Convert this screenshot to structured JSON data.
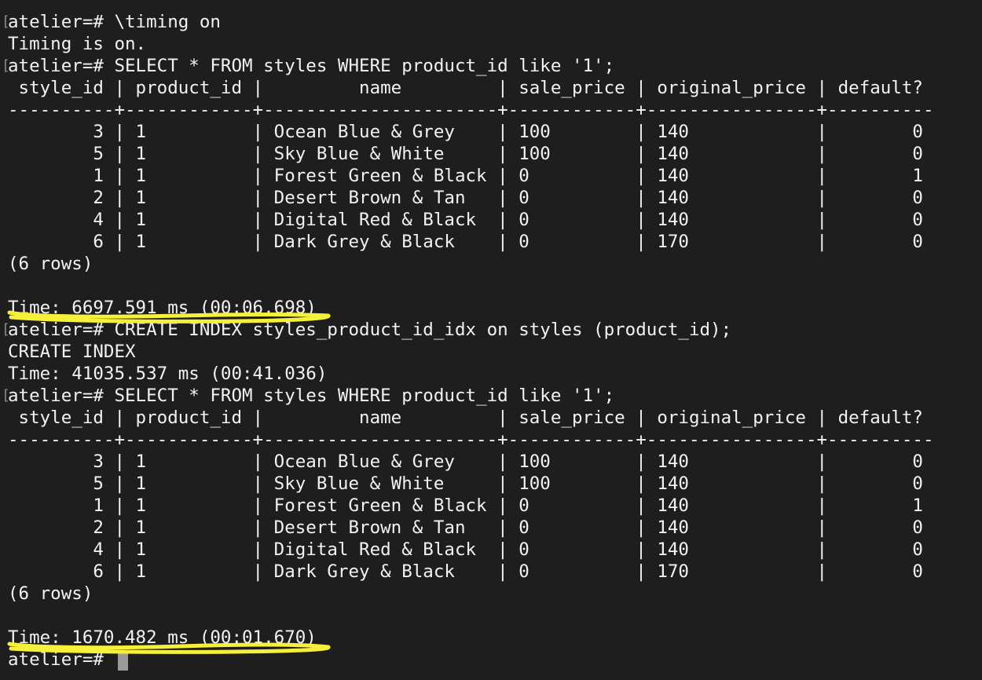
{
  "terminal": {
    "lines": [
      "atelier=# \\timing on",
      "Timing is on.",
      "atelier=# SELECT * FROM styles WHERE product_id like '1';",
      " style_id | product_id |         name         | sale_price | original_price | default?",
      "----------+------------+----------------------+------------+----------------+----------",
      "        3 | 1          | Ocean Blue & Grey    | 100        | 140            |        0",
      "        5 | 1          | Sky Blue & White     | 100        | 140            |        0",
      "        1 | 1          | Forest Green & Black | 0          | 140            |        1",
      "        2 | 1          | Desert Brown & Tan   | 0          | 140            |        0",
      "        4 | 1          | Digital Red & Black  | 0          | 140            |        0",
      "        6 | 1          | Dark Grey & Black    | 0          | 170            |        0",
      "(6 rows)",
      "",
      "Time: 6697.591 ms (00:06.698)",
      "atelier=# CREATE INDEX styles_product_id_idx on styles (product_id);",
      "CREATE INDEX",
      "Time: 41035.537 ms (00:41.036)",
      "atelier=# SELECT * FROM styles WHERE product_id like '1';",
      " style_id | product_id |         name         | sale_price | original_price | default?",
      "----------+------------+----------------------+------------+----------------+----------",
      "        3 | 1          | Ocean Blue & Grey    | 100        | 140            |        0",
      "        5 | 1          | Sky Blue & White     | 100        | 140            |        0",
      "        1 | 1          | Forest Green & Black | 0          | 140            |        1",
      "        2 | 1          | Desert Brown & Tan   | 0          | 140            |        0",
      "        4 | 1          | Digital Red & Black  | 0          | 140            |        0",
      "        6 | 1          | Dark Grey & Black    | 0          | 170            |        0",
      "(6 rows)",
      "",
      "Time: 1670.482 ms (00:01.670)",
      "atelier=# "
    ]
  },
  "colors": {
    "background": "#1e1e1e",
    "text": "#f2f2f2",
    "highlight": "#f5f03a",
    "cursor": "#9a9a9a"
  }
}
